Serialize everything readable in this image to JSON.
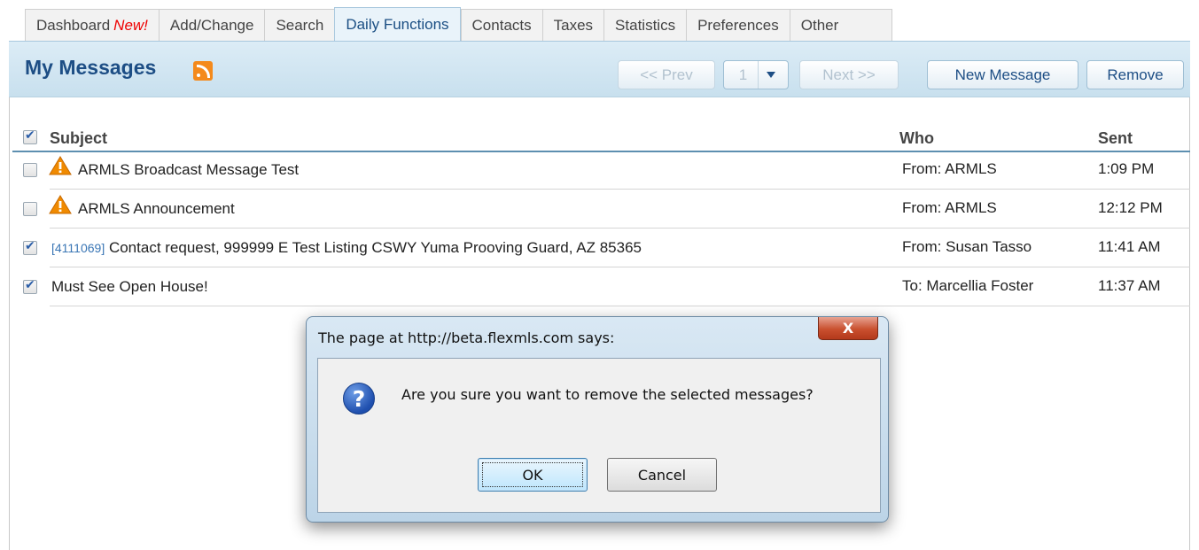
{
  "tabs": [
    {
      "label": "Dashboard",
      "badge": "New!"
    },
    {
      "label": "Add/Change"
    },
    {
      "label": "Search"
    },
    {
      "label": "Daily Functions",
      "active": true
    },
    {
      "label": "Contacts"
    },
    {
      "label": "Taxes"
    },
    {
      "label": "Statistics"
    },
    {
      "label": "Preferences"
    },
    {
      "label": "Other"
    }
  ],
  "header": {
    "title": "My Messages",
    "prev_label": "<< Prev",
    "page_number": "1",
    "next_label": "Next >>",
    "new_message_label": "New Message",
    "remove_label": "Remove"
  },
  "columns": {
    "subject": "Subject",
    "who": "Who",
    "sent": "Sent"
  },
  "messages": [
    {
      "checked": false,
      "warning": true,
      "ref": "",
      "subject": "ARMLS Broadcast Message Test",
      "who": "From: ARMLS",
      "sent": "1:09 PM"
    },
    {
      "checked": false,
      "warning": true,
      "ref": "",
      "subject": "ARMLS Announcement",
      "who": "From: ARMLS",
      "sent": "12:12 PM"
    },
    {
      "checked": true,
      "warning": false,
      "ref": "[4111069]",
      "subject": "Contact request, 999999 E Test Listing CSWY Yuma Prooving Guard, AZ 85365",
      "who": "From: Susan Tasso",
      "sent": "11:41 AM"
    },
    {
      "checked": true,
      "warning": false,
      "ref": "",
      "subject": "Must See Open House!",
      "who": "To: Marcellia Foster",
      "sent": "11:37 AM"
    }
  ],
  "dialog": {
    "title": "The page at http://beta.flexmls.com says:",
    "close_label": "X",
    "message": "Are you sure you want to remove the selected messages?",
    "ok_label": "OK",
    "cancel_label": "Cancel"
  },
  "colors": {
    "accent": "#1d4e85",
    "header_band": "#c8e0ee",
    "new_badge": "#ee0000",
    "warning": "#f08a00"
  },
  "icons": {
    "rss": "rss-feed-icon",
    "warning": "warning-triangle-icon",
    "question": "question-icon"
  }
}
